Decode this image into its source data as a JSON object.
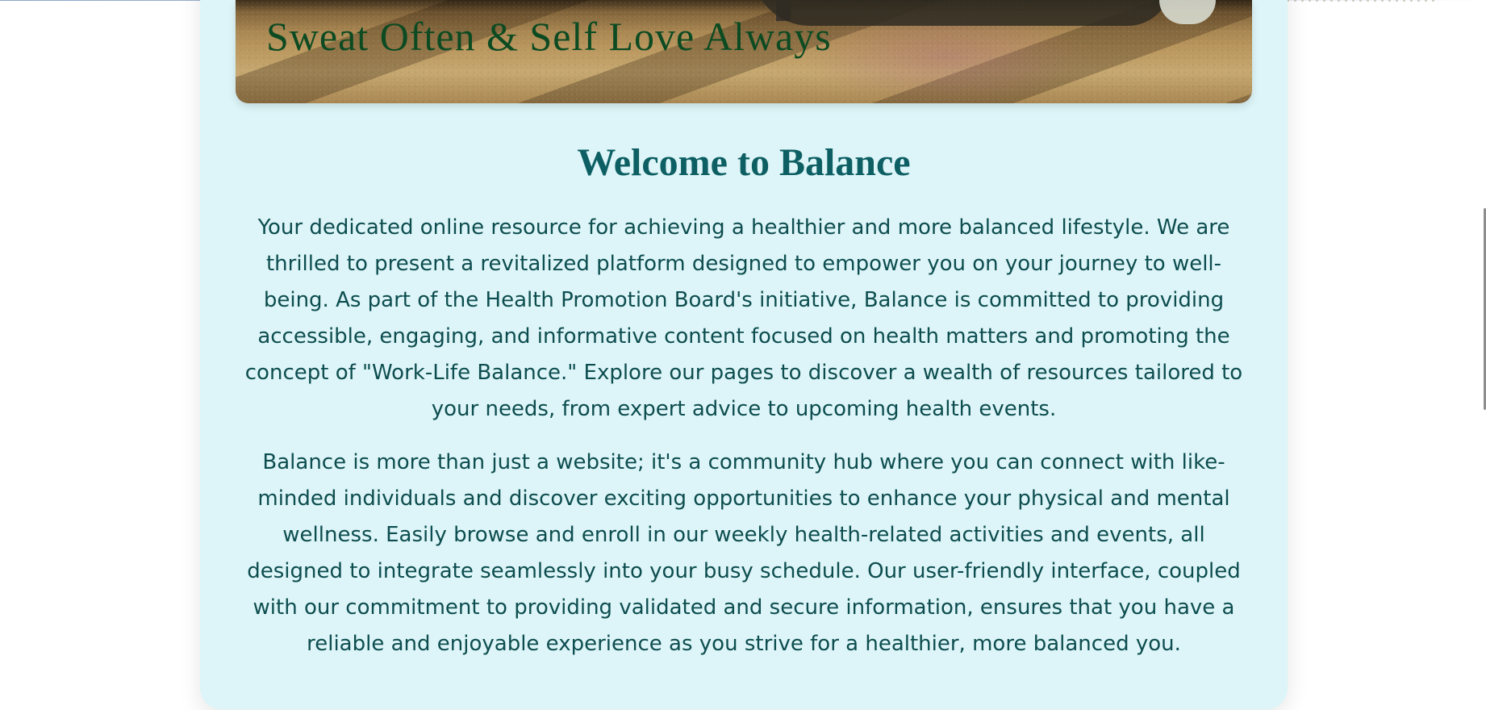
{
  "hero": {
    "title": "Sweat Often & Self Love Always"
  },
  "welcome": {
    "heading": "Welcome to Balance",
    "paragraphs": [
      "Your dedicated online resource for achieving a healthier and more balanced lifestyle. We are thrilled to present a revitalized platform designed to empower you on your journey to well-being. As part of the Health Promotion Board's initiative, Balance is committed to providing accessible, engaging, and informative content focused on health matters and promoting the concept of \"Work-Life Balance.\" Explore our pages to discover a wealth of resources tailored to your needs, from expert advice to upcoming health events.",
      "Balance is more than just a website; it's a community hub where you can connect with like-minded individuals and discover exciting opportunities to enhance your physical and mental wellness. Easily browse and enroll in our weekly health-related activities and events, all designed to integrate seamlessly into your busy schedule. Our user-friendly interface, coupled with our commitment to providing validated and secure information, ensures that you have a reliable and enjoyable experience as you strive for a healthier, more balanced you."
    ]
  },
  "colors": {
    "card_background": "#ddf5f8",
    "heading": "#0d5f63",
    "body_text": "#0d4d4f",
    "hero_title": "#0c4a22"
  }
}
